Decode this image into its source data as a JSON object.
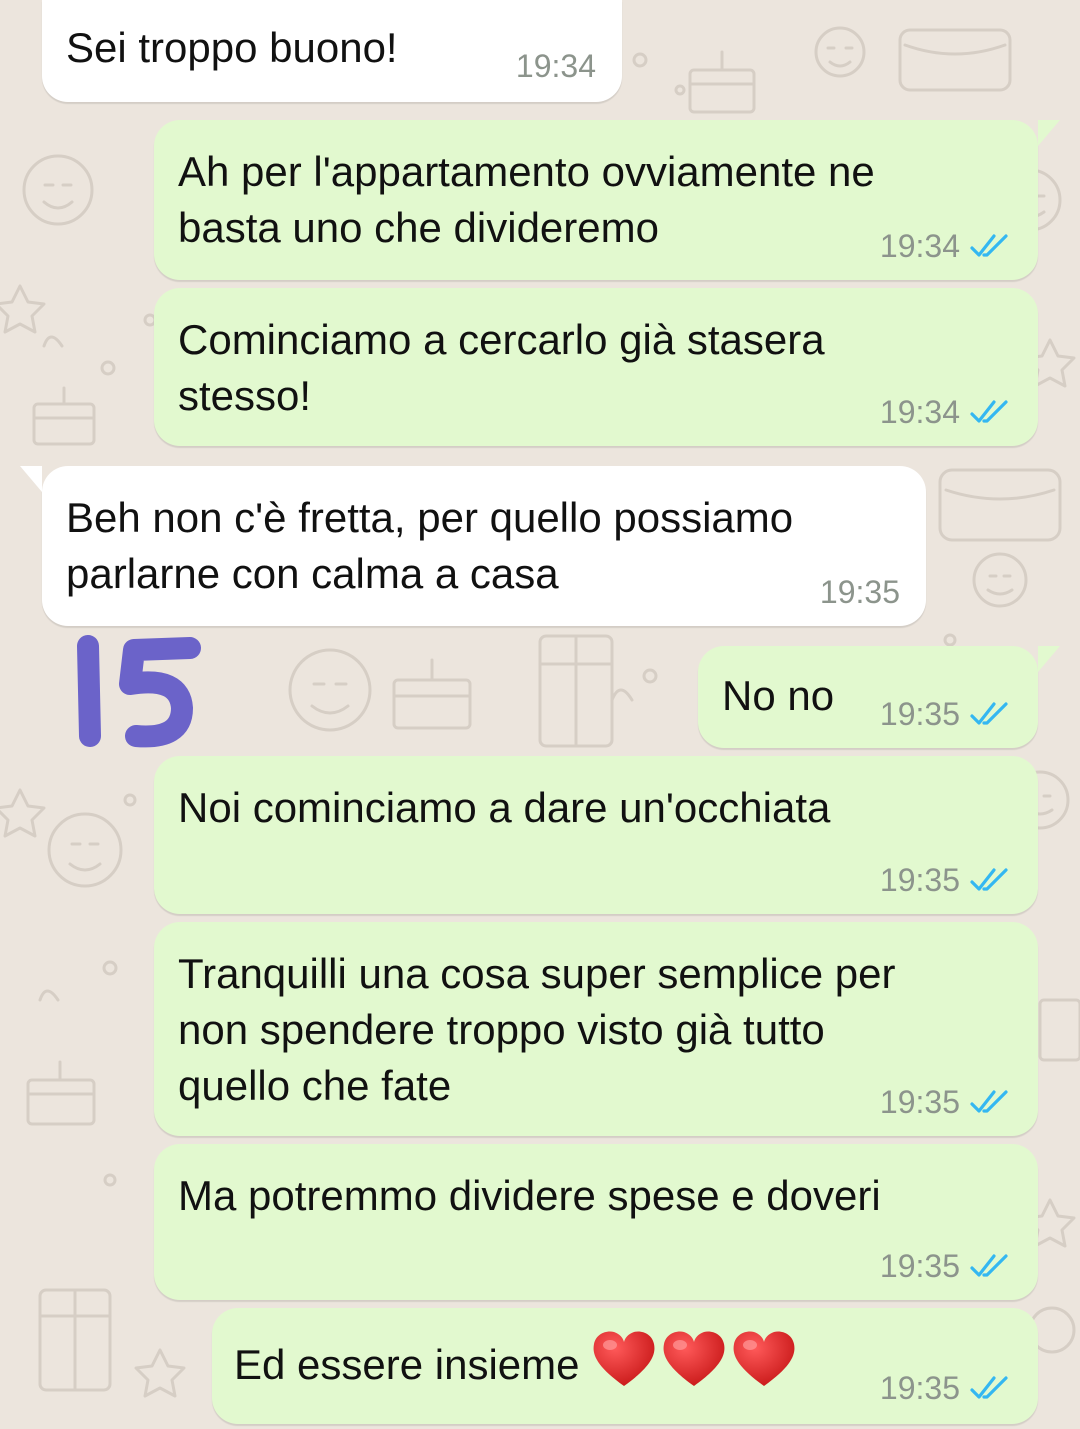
{
  "conversation": {
    "messages": [
      {
        "direction": "in",
        "text": "Sei troppo buono!",
        "time": "19:34"
      },
      {
        "direction": "out",
        "text": "Ah per l'appartamento ovviamente ne\nbasta uno che divideremo",
        "time": "19:34",
        "status": "read"
      },
      {
        "direction": "out",
        "text": "Cominciamo a cercarlo già stasera\nstesso!",
        "time": "19:34",
        "status": "read"
      },
      {
        "direction": "in",
        "text": "Beh non c'è fretta, per quello possiamo\nparlarne con calma a casa",
        "time": "19:35"
      },
      {
        "direction": "out",
        "text": "No no",
        "time": "19:35",
        "status": "read"
      },
      {
        "direction": "out",
        "text": "Noi cominciamo a dare un'occhiata",
        "time": "19:35",
        "status": "read"
      },
      {
        "direction": "out",
        "text": "Tranquilli una cosa super semplice per\nnon spendere troppo visto già tutto\nquello che fate",
        "time": "19:35",
        "status": "read"
      },
      {
        "direction": "out",
        "text": "Ma potremmo dividere spese e doveri",
        "time": "19:35",
        "status": "read"
      },
      {
        "direction": "out",
        "text": "Ed essere insieme",
        "time": "19:35",
        "status": "read",
        "emoji": [
          "heart-emoji",
          "heart-emoji",
          "heart-emoji"
        ]
      }
    ]
  },
  "annotation": {
    "label": "15",
    "color": "#6b63c9"
  },
  "colors": {
    "incoming_bubble": "#ffffff",
    "outgoing_bubble": "#e2f9cf",
    "read_ticks": "#34b7f1",
    "time_text": "#8c948c",
    "background": "#ece5dd"
  }
}
